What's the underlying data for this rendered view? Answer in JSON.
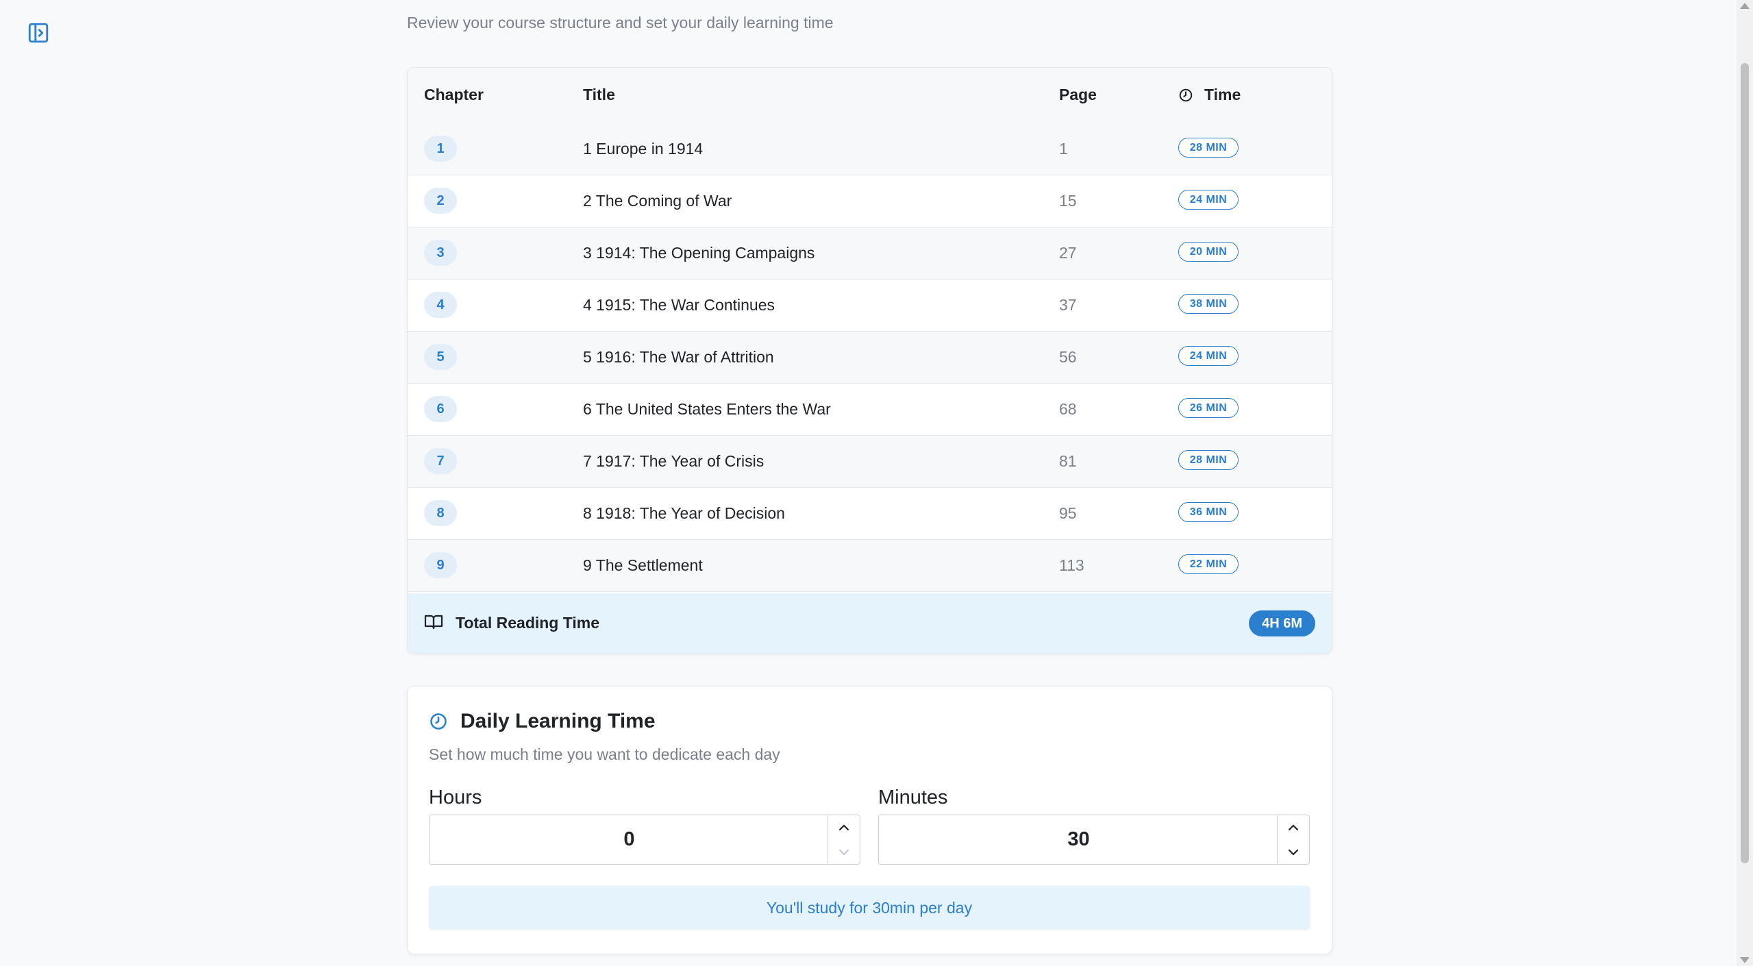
{
  "page": {
    "subtitle": "Review your course structure and set your daily learning time"
  },
  "icons": {
    "sidebar_toggle": "sidebar-panel-icon",
    "time_header": "clock-icon",
    "total": "book-open-icon",
    "daily": "clock-icon",
    "step_up": "chevron-up-icon",
    "step_down": "chevron-down-icon"
  },
  "colors": {
    "accent": "#2a7fcf",
    "chip_bg": "#e4eef8",
    "total_bg": "#e4f3fc"
  },
  "table": {
    "headers": {
      "chapter": "Chapter",
      "title": "Title",
      "page": "Page",
      "time": "Time"
    },
    "rows": [
      {
        "chapter": "1",
        "title": "1 Europe in 1914",
        "page": "1",
        "time": "28 MIN"
      },
      {
        "chapter": "2",
        "title": "2 The Coming of War",
        "page": "15",
        "time": "24 MIN"
      },
      {
        "chapter": "3",
        "title": "3 1914: The Opening Campaigns",
        "page": "27",
        "time": "20 MIN"
      },
      {
        "chapter": "4",
        "title": "4 1915: The War Continues",
        "page": "37",
        "time": "38 MIN"
      },
      {
        "chapter": "5",
        "title": "5 1916: The War of Attrition",
        "page": "56",
        "time": "24 MIN"
      },
      {
        "chapter": "6",
        "title": "6 The United States Enters the War",
        "page": "68",
        "time": "26 MIN"
      },
      {
        "chapter": "7",
        "title": "7 1917: The Year of Crisis",
        "page": "81",
        "time": "28 MIN"
      },
      {
        "chapter": "8",
        "title": "8 1918: The Year of Decision",
        "page": "95",
        "time": "36 MIN"
      },
      {
        "chapter": "9",
        "title": "9 The Settlement",
        "page": "113",
        "time": "22 MIN"
      }
    ],
    "total": {
      "label": "Total Reading Time",
      "value": "4H 6M"
    }
  },
  "daily": {
    "title": "Daily Learning Time",
    "subtitle": "Set how much time you want to dedicate each day",
    "hours": {
      "label": "Hours",
      "value": "0"
    },
    "minutes": {
      "label": "Minutes",
      "value": "30"
    },
    "summary": "You'll study for 30min per day"
  }
}
